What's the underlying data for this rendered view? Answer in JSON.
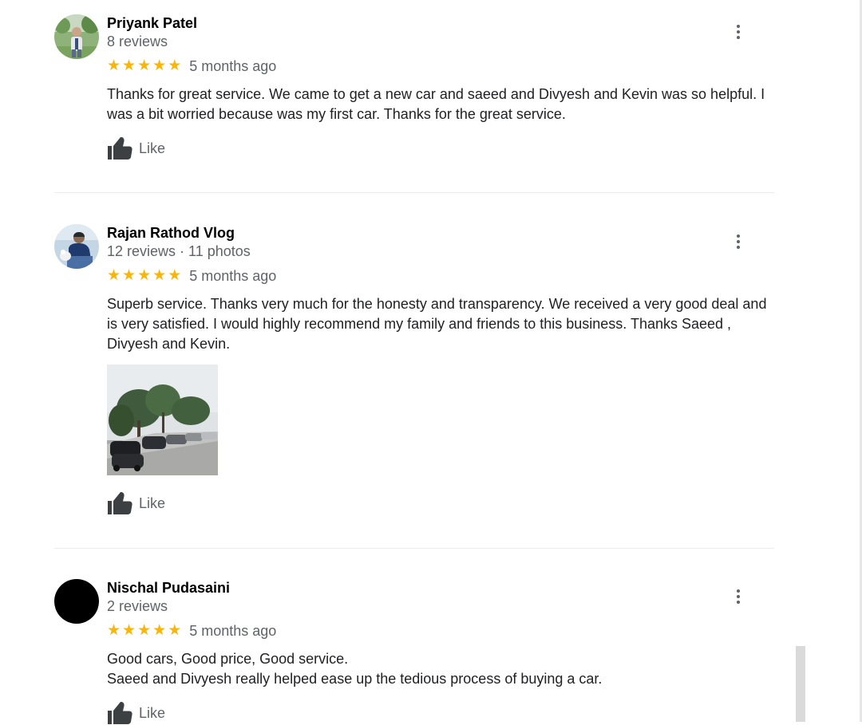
{
  "reviews": [
    {
      "name": "Priyank Patel",
      "meta": "8 reviews",
      "rating": 5,
      "time": "5 months ago",
      "text_lines": [
        "Thanks for great service. We came to get a new car and saeed and Divyesh and Kevin was so helpful. I",
        "was a bit worried because was my first car. Thanks for the great service."
      ],
      "like_label": "Like"
    },
    {
      "name": "Rajan Rathod Vlog",
      "meta": "12 reviews · 11 photos",
      "rating": 5,
      "time": "5 months ago",
      "text_lines": [
        "Superb service. Thanks very much for the honesty and transparency. We received a very good deal and",
        "is very satisfied. I would highly recommend my family and friends to this business. Thanks Saeed ,",
        "Divyesh and Kevin."
      ],
      "like_label": "Like"
    },
    {
      "name": "Nischal Pudasaini",
      "meta": "2 reviews",
      "rating": 5,
      "time": "5 months ago",
      "text_lines": [
        "Good cars, Good price, Good service.",
        "Saeed and Divyesh really helped ease up the tedious process of buying a car."
      ],
      "like_label": "Like"
    }
  ],
  "icons": {
    "star": "star-icon",
    "more": "more-vert-icon",
    "like": "thumbs-up-icon"
  },
  "colors": {
    "star": "#f9b608",
    "secondary_text": "#5f6368",
    "icon": "#3c4043"
  }
}
